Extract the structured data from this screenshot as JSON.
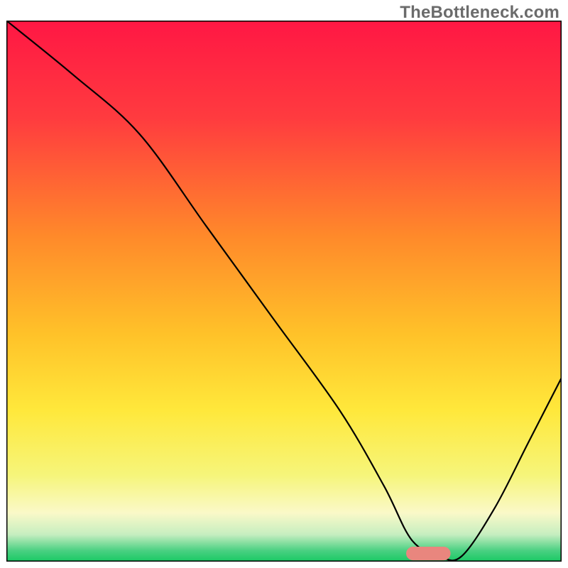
{
  "watermark": "TheBottleneck.com",
  "chart_data": {
    "type": "line",
    "title": "",
    "xlabel": "",
    "ylabel": "",
    "xlim": [
      0,
      100
    ],
    "ylim": [
      0,
      100
    ],
    "grid": false,
    "legend": false,
    "gradient_stops": [
      {
        "offset": 0,
        "color": "#ff1744"
      },
      {
        "offset": 18,
        "color": "#ff3b3f"
      },
      {
        "offset": 40,
        "color": "#ff8a2a"
      },
      {
        "offset": 58,
        "color": "#ffc229"
      },
      {
        "offset": 72,
        "color": "#ffe83b"
      },
      {
        "offset": 84,
        "color": "#f6f57a"
      },
      {
        "offset": 91,
        "color": "#faf9c8"
      },
      {
        "offset": 95,
        "color": "#c6eec0"
      },
      {
        "offset": 98,
        "color": "#49d081"
      },
      {
        "offset": 100,
        "color": "#19c964"
      }
    ],
    "series": [
      {
        "name": "bottleneck-curve",
        "color": "#000000",
        "x": [
          0,
          12,
          24,
          36,
          48,
          60,
          68,
          73,
          78,
          82,
          88,
          94,
          100
        ],
        "values": [
          100,
          90,
          79,
          62,
          45,
          28,
          14,
          4,
          1,
          1,
          10,
          22,
          34
        ]
      }
    ],
    "marker": {
      "name": "optimal-point",
      "x": 76,
      "y": 1.5,
      "width": 8,
      "height": 2.5,
      "color": "#e9867e"
    }
  }
}
